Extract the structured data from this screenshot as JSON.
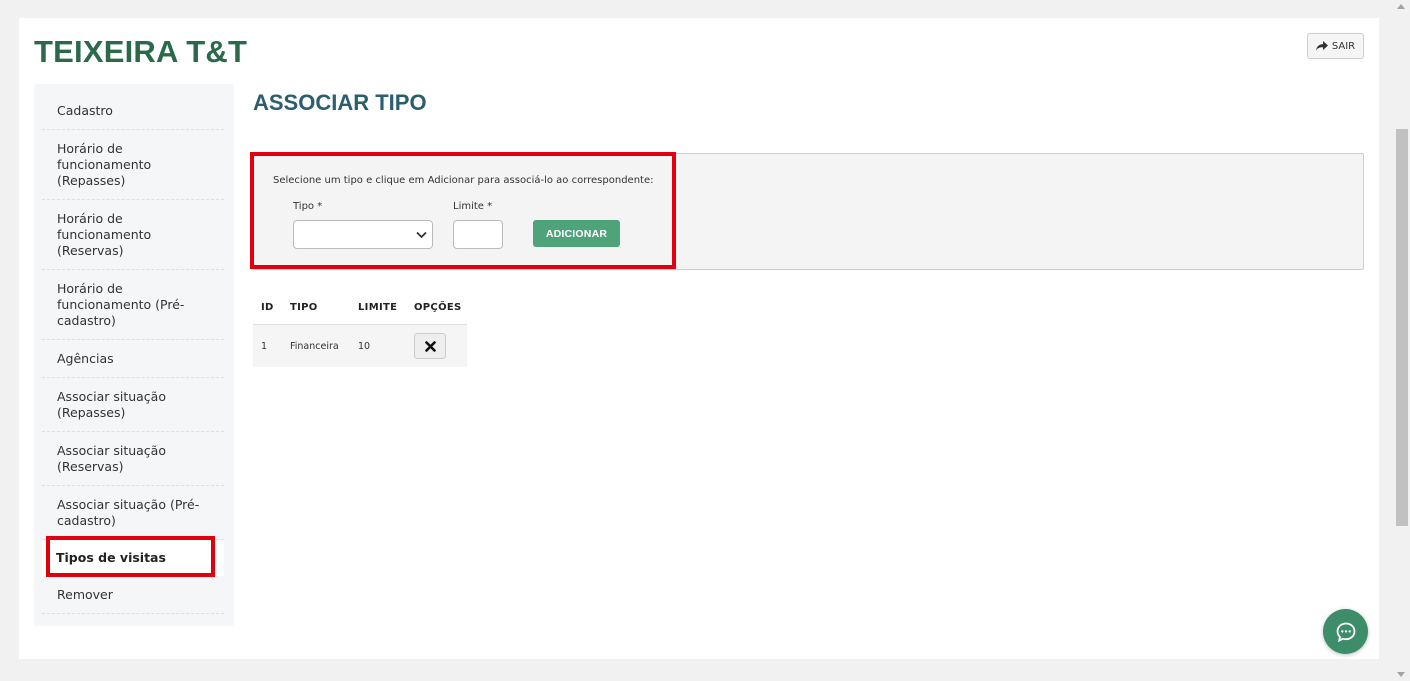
{
  "header": {
    "brand": "TEIXEIRA T&T",
    "logout_label": "SAIR"
  },
  "sidebar": {
    "items": [
      {
        "label": "Cadastro"
      },
      {
        "label": "Horário de funcionamento (Repasses)"
      },
      {
        "label": "Horário de funcionamento (Reservas)"
      },
      {
        "label": "Horário de funcionamento (Pré-cadastro)"
      },
      {
        "label": "Agências"
      },
      {
        "label": "Associar situação (Repasses)"
      },
      {
        "label": "Associar situação (Reservas)"
      },
      {
        "label": "Associar situação (Pré-cadastro)"
      },
      {
        "label": "Tipos de visitas",
        "active": true
      },
      {
        "label": "Remover"
      }
    ]
  },
  "main": {
    "title": "ASSOCIAR TIPO",
    "form": {
      "hint": "Selecione um tipo e clique em Adicionar para associá-lo ao correspondente:",
      "tipo_label": "Tipo *",
      "tipo_value": "",
      "limite_label": "Limite *",
      "limite_value": "",
      "add_label": "ADICIONAR"
    },
    "table": {
      "headers": [
        "ID",
        "TIPO",
        "LIMITE",
        "OPÇÕES"
      ],
      "rows": [
        {
          "id": "1",
          "tipo": "Financeira",
          "limite": "10"
        }
      ]
    }
  },
  "colors": {
    "brand": "#2a6a4a",
    "title": "#2b5e6e",
    "accent": "#4fa37b",
    "highlight": "#e0000f",
    "chat": "#3d8d6b"
  },
  "icons": {
    "logout": "share-arrow-icon",
    "delete": "close-x-icon",
    "chat": "chat-bubble-icon",
    "select": "chevron-down-icon"
  }
}
